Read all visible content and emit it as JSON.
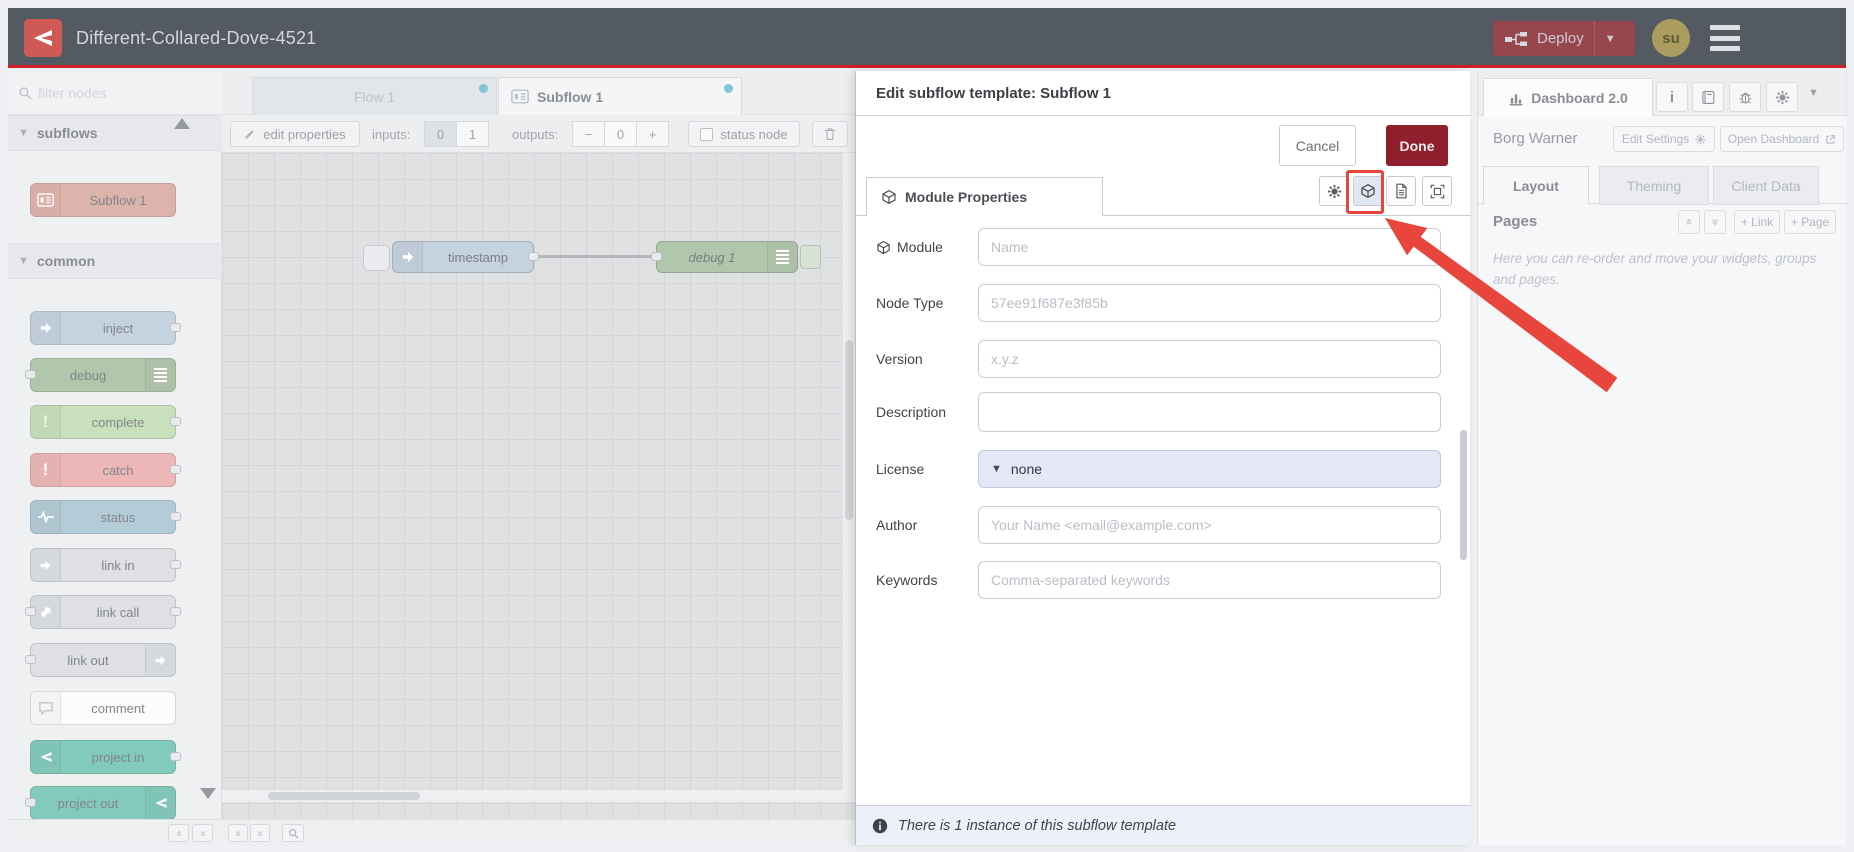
{
  "header": {
    "title": "Different-Collared-Dove-4521",
    "deploy_label": "Deploy",
    "avatar": "su"
  },
  "palette": {
    "filter_placeholder": "filter nodes",
    "categories": [
      {
        "label": "subflows",
        "items": [
          {
            "label": "Subflow 1"
          }
        ]
      },
      {
        "label": "common",
        "items": [
          {
            "label": "inject"
          },
          {
            "label": "debug"
          },
          {
            "label": "complete"
          },
          {
            "label": "catch"
          },
          {
            "label": "status"
          },
          {
            "label": "link in"
          },
          {
            "label": "link call"
          },
          {
            "label": "link out"
          },
          {
            "label": "comment"
          },
          {
            "label": "project in"
          },
          {
            "label": "project out"
          }
        ]
      }
    ]
  },
  "workspace": {
    "tabs": [
      {
        "label": "Flow 1"
      },
      {
        "label": "Subflow 1"
      }
    ],
    "toolbar": {
      "edit_properties": "edit properties",
      "inputs_label": "inputs:",
      "input_options": [
        "0",
        "1"
      ],
      "outputs_label": "outputs:",
      "output_minus": "−",
      "output_value": "0",
      "output_plus": "+",
      "status_node": "status node"
    },
    "nodes": [
      {
        "label": "timestamp"
      },
      {
        "label": "debug 1"
      }
    ]
  },
  "dialog": {
    "title": "Edit subflow template: Subflow 1",
    "cancel": "Cancel",
    "done": "Done",
    "tab": "Module Properties",
    "fields": [
      {
        "label": "Module",
        "placeholder": "Name"
      },
      {
        "label": "Node Type",
        "placeholder": "57ee91f687e3f85b"
      },
      {
        "label": "Version",
        "placeholder": "x.y.z"
      },
      {
        "label": "Description",
        "placeholder": ""
      },
      {
        "label": "License",
        "value": "none"
      },
      {
        "label": "Author",
        "placeholder": "Your Name <email@example.com>"
      },
      {
        "label": "Keywords",
        "placeholder": "Comma-separated keywords"
      }
    ],
    "footer": "There is 1 instance of this subflow template"
  },
  "sidebar": {
    "tab": "Dashboard 2.0",
    "app_name": "Borg Warner",
    "edit_settings": "Edit Settings",
    "open_dashboard": "Open Dashboard",
    "tabs": [
      {
        "label": "Layout"
      },
      {
        "label": "Theming"
      },
      {
        "label": "Client Data"
      }
    ],
    "pages": {
      "title": "Pages",
      "link_button": "+ Link",
      "page_button": "+ Page",
      "description": "Here you can re-order and move your widgets, groups and pages."
    }
  },
  "colors": {
    "accent_red": "#e8453c",
    "header": "#545a62",
    "header_underline": "#d21e24",
    "deploy_bg": "#97464e",
    "done_bg": "#8f1f2c"
  }
}
